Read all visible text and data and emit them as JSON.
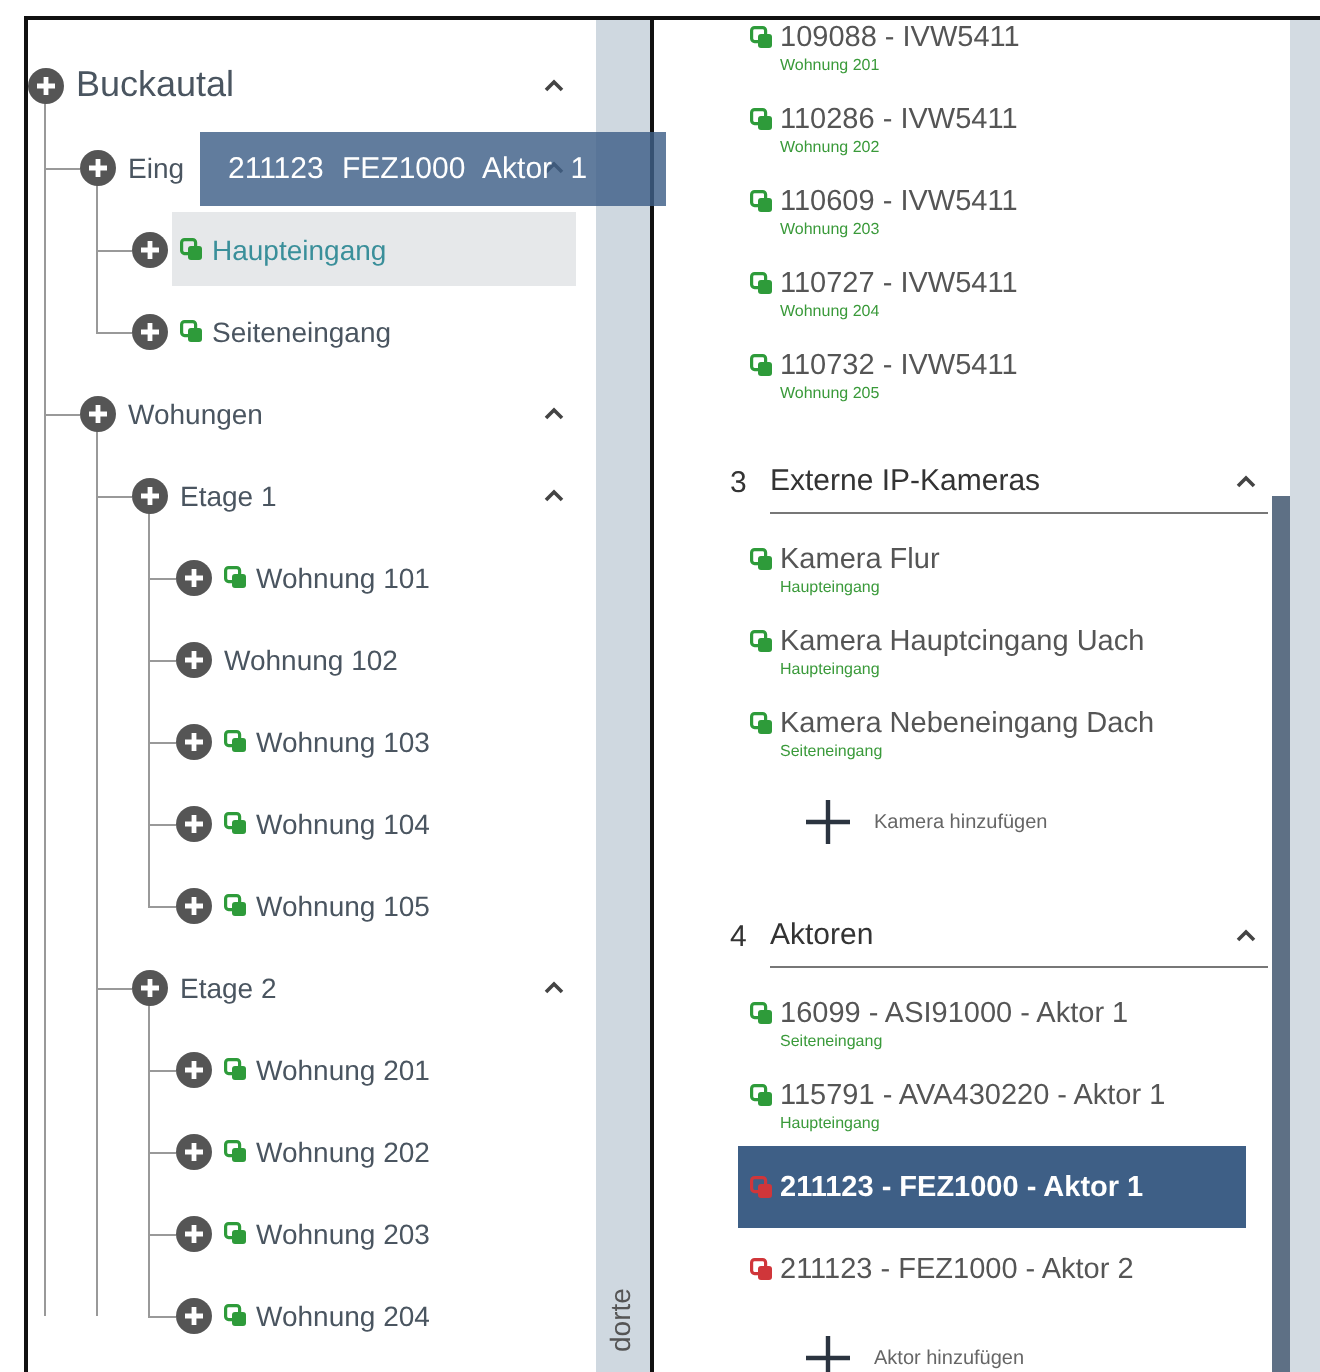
{
  "tree": [
    {
      "label": "Buckautal",
      "linked": false,
      "selected": false,
      "expanded": true,
      "children": [
        {
          "label": "Eing",
          "linked": false,
          "selected": false,
          "expanded": true,
          "children": [
            {
              "label": "Haupteingang",
              "linked": true,
              "selected": true
            },
            {
              "label": "Seiteneingang",
              "linked": true,
              "selected": false
            }
          ]
        },
        {
          "label": "Wohungen",
          "linked": false,
          "selected": false,
          "expanded": true,
          "children": [
            {
              "label": "Etage 1",
              "linked": false,
              "selected": false,
              "expanded": true,
              "children": [
                {
                  "label": "Wohnung 101",
                  "linked": true,
                  "selected": false
                },
                {
                  "label": "Wohnung 102",
                  "linked": false,
                  "selected": false
                },
                {
                  "label": "Wohnung 103",
                  "linked": true,
                  "selected": false
                },
                {
                  "label": "Wohnung 104",
                  "linked": true,
                  "selected": false
                },
                {
                  "label": "Wohnung 105",
                  "linked": true,
                  "selected": false
                }
              ]
            },
            {
              "label": "Etage 2",
              "linked": false,
              "selected": false,
              "expanded": true,
              "children": [
                {
                  "label": "Wohnung 201",
                  "linked": true,
                  "selected": false
                },
                {
                  "label": "Wohnung 202",
                  "linked": true,
                  "selected": false
                },
                {
                  "label": "Wohnung 203",
                  "linked": true,
                  "selected": false
                },
                {
                  "label": "Wohnung 204",
                  "linked": true,
                  "selected": false
                }
              ]
            }
          ]
        }
      ]
    }
  ],
  "side_tab": {
    "label": "dorte"
  },
  "drag_ghost": {
    "label": "211123 FEZ1000 Aktor 1"
  },
  "devices": [
    {
      "name": "109088 - IVW5411",
      "location": "Wohnung 201",
      "color": "#2e9b3a",
      "selected": false
    },
    {
      "name": "110286 - IVW5411",
      "location": "Wohnung 202",
      "color": "#2e9b3a",
      "selected": false
    },
    {
      "name": "110609 - IVW5411",
      "location": "Wohnung 203",
      "color": "#2e9b3a",
      "selected": false
    },
    {
      "name": "110727 - IVW5411",
      "location": "Wohnung 204",
      "color": "#2e9b3a",
      "selected": false
    },
    {
      "name": "110732 - IVW5411",
      "location": "Wohnung 205",
      "color": "#2e9b3a",
      "selected": false
    }
  ],
  "sections": [
    {
      "number": "3",
      "title": "Externe IP-Kameras",
      "expanded": true,
      "add_label": "Kamera hinzufügen",
      "items": [
        {
          "name": "Kamera Flur",
          "location": "Haupteingang",
          "color": "#2e9b3a",
          "selected": false
        },
        {
          "name": "Kamera Hauptcingang Uach",
          "location": "Haupteingang",
          "color": "#2e9b3a",
          "selected": false
        },
        {
          "name": "Kamera Nebeneingang Dach",
          "location": "Seiteneingang",
          "color": "#2e9b3a",
          "selected": false
        }
      ]
    },
    {
      "number": "4",
      "title": "Aktoren",
      "expanded": true,
      "add_label": "Aktor hinzufügen",
      "items": [
        {
          "name": "16099 - ASI91000 - Aktor 1",
          "location": "Seiteneingang",
          "color": "#2e9b3a",
          "selected": false
        },
        {
          "name": "115791 - AVA430220 - Aktor 1",
          "location": "Haupteingang",
          "color": "#2e9b3a",
          "selected": false
        },
        {
          "name": "211123 - FEZ1000 - Aktor 1",
          "color": "#d0363a",
          "selected": true
        },
        {
          "name": "211123 - FEZ1000 - Aktor 2",
          "color": "#d0363a",
          "selected": false
        }
      ]
    }
  ]
}
